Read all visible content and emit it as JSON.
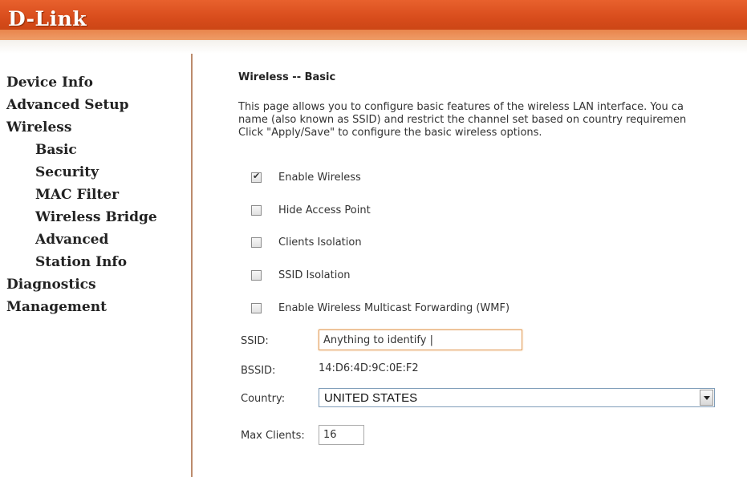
{
  "header": {
    "logo_text": "D-Link"
  },
  "sidebar": {
    "items": [
      {
        "label": "Device Info"
      },
      {
        "label": "Advanced Setup"
      },
      {
        "label": "Wireless"
      },
      {
        "label": "Basic"
      },
      {
        "label": "Security"
      },
      {
        "label": "MAC Filter"
      },
      {
        "label": "Wireless Bridge"
      },
      {
        "label": "Advanced"
      },
      {
        "label": "Station Info"
      },
      {
        "label": "Diagnostics"
      },
      {
        "label": "Management"
      }
    ]
  },
  "main": {
    "title": "Wireless -- Basic",
    "description_lines": [
      "This page allows you to configure basic features of the wireless LAN interface. You ca",
      "name (also known as SSID) and restrict the channel set based on country requiremen",
      "Click \"Apply/Save\" to configure the basic wireless options."
    ],
    "checkboxes": [
      {
        "label": "Enable Wireless",
        "checked": true
      },
      {
        "label": "Hide Access Point",
        "checked": false
      },
      {
        "label": "Clients Isolation",
        "checked": false
      },
      {
        "label": "SSID Isolation",
        "checked": false
      },
      {
        "label": "Enable Wireless Multicast Forwarding (WMF)",
        "checked": false
      }
    ],
    "ssid": {
      "label": "SSID:",
      "value": "Anything to identify |"
    },
    "bssid": {
      "label": "BSSID:",
      "value": "14:D6:4D:9C:0E:F2"
    },
    "country": {
      "label": "Country:",
      "value": "UNITED STATES"
    },
    "max_clients": {
      "label": "Max Clients:",
      "value": "16"
    }
  },
  "colors": {
    "header_orange": "#d84c1c",
    "sidebar_border": "#bc8b6c",
    "input_focus": "#e3a060"
  }
}
